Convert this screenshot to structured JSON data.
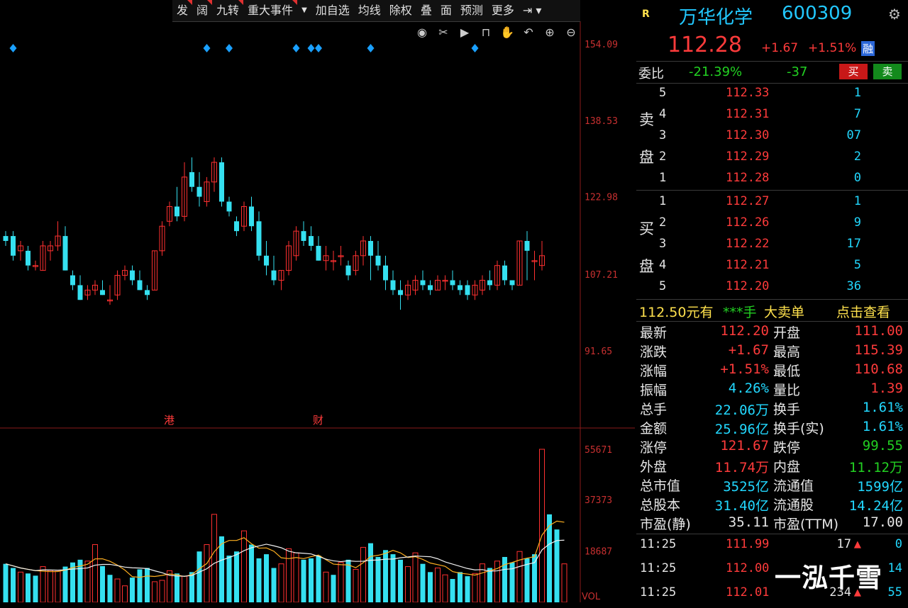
{
  "toolbar": {
    "items": [
      "发",
      "阔",
      "九转",
      "重大事件",
      "加自选",
      "均线",
      "除权",
      "叠",
      "面",
      "预测",
      "更多"
    ]
  },
  "chart_data": [
    {
      "type": "candlestick",
      "ylim": [
        91.65,
        154.09
      ],
      "y_ticks": [
        "154.09",
        "138.53",
        "122.98",
        "107.21",
        "91.65"
      ],
      "event_markers": [
        "港",
        "财"
      ],
      "candles": [
        [
          115,
          116,
          113,
          114
        ],
        [
          115,
          116,
          110,
          111
        ],
        [
          112,
          114,
          110,
          113
        ],
        [
          112,
          113,
          108,
          109
        ],
        [
          109,
          110,
          108,
          109
        ],
        [
          108,
          114,
          108,
          113
        ],
        [
          112,
          114,
          110,
          113
        ],
        [
          113,
          118,
          112,
          115
        ],
        [
          115,
          117,
          108,
          108
        ],
        [
          107,
          108,
          104,
          105
        ],
        [
          105,
          107,
          102,
          102
        ],
        [
          103,
          105,
          102,
          104
        ],
        [
          104,
          106,
          103,
          105
        ],
        [
          104,
          106,
          103,
          103
        ],
        [
          102,
          105,
          101,
          102
        ],
        [
          103,
          108,
          102,
          107
        ],
        [
          107,
          109,
          106,
          108
        ],
        [
          108,
          109,
          105,
          106
        ],
        [
          106,
          108,
          104,
          104
        ],
        [
          104,
          105,
          102,
          103
        ],
        [
          104,
          112,
          104,
          112
        ],
        [
          112,
          118,
          111,
          117
        ],
        [
          118,
          122,
          117,
          121
        ],
        [
          121,
          125,
          118,
          119
        ],
        [
          119,
          130,
          118,
          127
        ],
        [
          128,
          131,
          124,
          125
        ],
        [
          125,
          128,
          121,
          123
        ],
        [
          122,
          127,
          121,
          126
        ],
        [
          126,
          131,
          124,
          130
        ],
        [
          130,
          131,
          121,
          122
        ],
        [
          122,
          123,
          119,
          120
        ],
        [
          118,
          119,
          115,
          116
        ],
        [
          117,
          122,
          116,
          121
        ],
        [
          121,
          123,
          116,
          117
        ],
        [
          118,
          120,
          110,
          111
        ],
        [
          111,
          114,
          107,
          109
        ],
        [
          108,
          111,
          105,
          106
        ],
        [
          106,
          108,
          104,
          108
        ],
        [
          108,
          114,
          107,
          113
        ],
        [
          111,
          117,
          110,
          116
        ],
        [
          116,
          118,
          113,
          114
        ],
        [
          115,
          117,
          112,
          113
        ],
        [
          113,
          115,
          110,
          110
        ],
        [
          110,
          113,
          108,
          111
        ],
        [
          110,
          112,
          108,
          110
        ],
        [
          111,
          113,
          109,
          111
        ],
        [
          109,
          110,
          106,
          107
        ],
        [
          108,
          112,
          107,
          111
        ],
        [
          111,
          115,
          109,
          114
        ],
        [
          114,
          115,
          106,
          111
        ],
        [
          111,
          114,
          108,
          109
        ],
        [
          109,
          111,
          104,
          106
        ],
        [
          106,
          108,
          103,
          104
        ],
        [
          104,
          106,
          100,
          103
        ],
        [
          103,
          106,
          102,
          105
        ],
        [
          104,
          107,
          103,
          106
        ],
        [
          106,
          108,
          104,
          105
        ],
        [
          105,
          106,
          103,
          104
        ],
        [
          104,
          107,
          104,
          106
        ],
        [
          106,
          107,
          104,
          106
        ],
        [
          106,
          108,
          104,
          105
        ],
        [
          105,
          106,
          103,
          104
        ],
        [
          105,
          106,
          102,
          103
        ],
        [
          103,
          106,
          102,
          105
        ],
        [
          104,
          107,
          103,
          106
        ],
        [
          106,
          108,
          104,
          105
        ],
        [
          105,
          110,
          104,
          109
        ],
        [
          109,
          110,
          105,
          106
        ],
        [
          106,
          106,
          104,
          105
        ],
        [
          105,
          114,
          105,
          114
        ],
        [
          114,
          116,
          106,
          112
        ],
        [
          110,
          112,
          106,
          110
        ],
        [
          109,
          114,
          108,
          111
        ]
      ]
    },
    {
      "type": "bar",
      "ylim": [
        0,
        55671
      ],
      "y_ticks": [
        "55671",
        "37373",
        "18687"
      ],
      "indicator": "VOL",
      "values": [
        14000,
        12500,
        11000,
        10500,
        9700,
        13000,
        11600,
        11300,
        13000,
        14500,
        15500,
        15000,
        21000,
        13200,
        10000,
        8500,
        6000,
        9000,
        12000,
        12500,
        7500,
        8000,
        11500,
        10500,
        9500,
        11000,
        18500,
        21000,
        32000,
        24000,
        17000,
        18500,
        26000,
        21000,
        16000,
        17500,
        12500,
        14000,
        19500,
        18000,
        15500,
        16000,
        17000,
        11000,
        10000,
        14500,
        15500,
        12000,
        20000,
        21500,
        16500,
        19000,
        17500,
        15500,
        13000,
        18000,
        14000,
        11000,
        12500,
        10000,
        8500,
        11000,
        9500,
        10500,
        14000,
        12500,
        15000,
        16500,
        14500,
        18500,
        16000,
        17500,
        55671,
        32000,
        26500,
        14000
      ],
      "up": [
        false,
        false,
        true,
        false,
        false,
        true,
        true,
        true,
        false,
        false,
        false,
        true,
        true,
        false,
        false,
        true,
        true,
        false,
        false,
        false,
        true,
        true,
        true,
        false,
        true,
        false,
        false,
        true,
        true,
        false,
        false,
        false,
        true,
        false,
        false,
        false,
        false,
        true,
        true,
        true,
        false,
        false,
        false,
        true,
        false,
        true,
        false,
        true,
        true,
        false,
        false,
        false,
        false,
        false,
        true,
        true,
        false,
        false,
        true,
        true,
        false,
        false,
        false,
        true,
        true,
        false,
        true,
        false,
        false,
        true,
        false,
        false,
        true,
        false,
        false,
        true
      ]
    }
  ],
  "header": {
    "r_badge": "R",
    "name": "万华化学",
    "code": "600309",
    "price": "112.28",
    "change": "+1.67",
    "pct": "+1.51%",
    "flag": "融"
  },
  "weibi": {
    "label": "委比",
    "ratio": "-21.39%",
    "diff": "-37",
    "buy_btn": "买",
    "sell_btn": "卖"
  },
  "orderbook": {
    "sell_label_1": "卖",
    "sell_label_2": "盘",
    "buy_label_1": "买",
    "buy_label_2": "盘",
    "asks": [
      {
        "lvl": "5",
        "price": "112.33",
        "vol": "1"
      },
      {
        "lvl": "4",
        "price": "112.31",
        "vol": "7"
      },
      {
        "lvl": "3",
        "price": "112.30",
        "vol": "07"
      },
      {
        "lvl": "2",
        "price": "112.29",
        "vol": "2"
      },
      {
        "lvl": "1",
        "price": "112.28",
        "vol": "0"
      }
    ],
    "bids": [
      {
        "lvl": "1",
        "price": "112.27",
        "vol": "1"
      },
      {
        "lvl": "2",
        "price": "112.26",
        "vol": "9"
      },
      {
        "lvl": "3",
        "price": "112.22",
        "vol": "17"
      },
      {
        "lvl": "4",
        "price": "112.21",
        "vol": "5"
      },
      {
        "lvl": "5",
        "price": "112.20",
        "vol": "36"
      }
    ]
  },
  "bigorder": {
    "price": "112.50元有",
    "stars": "***手",
    "label": "大卖单",
    "link": "点击查看"
  },
  "stats": [
    {
      "l1": "最新",
      "v1": "112.20",
      "c1": "red",
      "l2": "开盘",
      "v2": "111.00",
      "c2": "red"
    },
    {
      "l1": "涨跌",
      "v1": "+1.67",
      "c1": "red",
      "l2": "最高",
      "v2": "115.39",
      "c2": "red"
    },
    {
      "l1": "涨幅",
      "v1": "+1.51%",
      "c1": "red",
      "l2": "最低",
      "v2": "110.68",
      "c2": "red"
    },
    {
      "l1": "振幅",
      "v1": "4.26%",
      "c1": "cyan",
      "l2": "量比",
      "v2": "1.39",
      "c2": "red"
    },
    {
      "l1": "总手",
      "v1": "22.06万",
      "c1": "cyan",
      "l2": "换手",
      "v2": "1.61%",
      "c2": "cyan"
    },
    {
      "l1": "金额",
      "v1": "25.96亿",
      "c1": "cyan",
      "l2": "换手(实)",
      "v2": "1.61%",
      "c2": "cyan"
    },
    {
      "l1": "涨停",
      "v1": "121.67",
      "c1": "red",
      "l2": "跌停",
      "v2": "99.55",
      "c2": "green"
    },
    {
      "l1": "外盘",
      "v1": "11.74万",
      "c1": "red",
      "l2": "内盘",
      "v2": "11.12万",
      "c2": "green"
    },
    {
      "l1": "总市值",
      "v1": "3525亿",
      "c1": "cyan",
      "l2": "流通值",
      "v2": "1599亿",
      "c2": "cyan"
    },
    {
      "l1": "总股本",
      "v1": "31.40亿",
      "c1": "cyan",
      "l2": "流通股",
      "v2": "14.24亿",
      "c2": "cyan"
    },
    {
      "l1": "市盈(静)",
      "v1": "35.11",
      "c1": "white",
      "l2": "市盈(TTM)",
      "v2": "17.00",
      "c2": "white"
    }
  ],
  "ticks": [
    {
      "t": "11:25",
      "p": "111.99",
      "v": "17",
      "n": "0"
    },
    {
      "t": "11:25",
      "p": "112.00",
      "v": "",
      "n": "14"
    },
    {
      "t": "11:25",
      "p": "112.01",
      "v": "234",
      "n": "55"
    }
  ],
  "watermark": "一泓千雪",
  "colors": {
    "up": "#ff3030",
    "down": "#35e0f0",
    "bg": "#000000",
    "price_red": "#ff3b3b",
    "cyan": "#22d8ff"
  }
}
